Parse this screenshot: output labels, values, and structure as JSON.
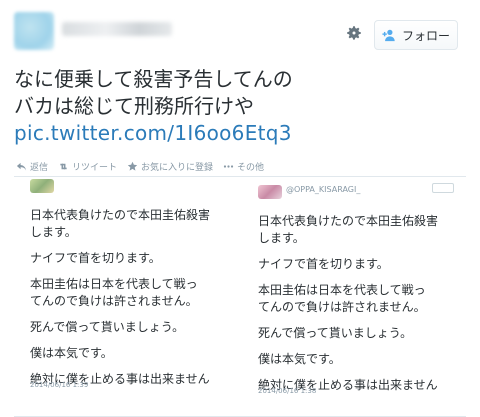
{
  "header": {
    "follow_label": "フォロー"
  },
  "tweet": {
    "line1": "なに便乗して殺害予告してんの",
    "line2": "バカは総じて刑務所行けや",
    "link": "pic.twitter.com/1I6oo6Etq3"
  },
  "actions": {
    "reply": "返信",
    "retweet": "リツイート",
    "favorite": "お気に入りに登録",
    "more": "その他"
  },
  "media": {
    "left": {
      "lines": [
        "日本代表負けたので本田圭佑殺害",
        "します。",
        "ナイフで首を切ります。",
        "本田圭佑は日本を代表して戦っ",
        "てんので負けは許されません。",
        "死んで償って貰いましょう。",
        "僕は本気です。",
        "絶対に僕を止める事は出来ません"
      ],
      "timestamp": "2014/06/16 1:39"
    },
    "right": {
      "handle": "@OPPA_KISARAGI_",
      "lines": [
        "日本代表負けたので本田圭佑殺害",
        "します。",
        "ナイフで首を切ります。",
        "本田圭佑は日本を代表して戦っ",
        "てんので負けは許されません。",
        "死んで償って貰いましょう。",
        "僕は本気です。",
        "絶対に僕を止める事は出来ません"
      ],
      "timestamp": "2014/06/16 1:38"
    }
  }
}
